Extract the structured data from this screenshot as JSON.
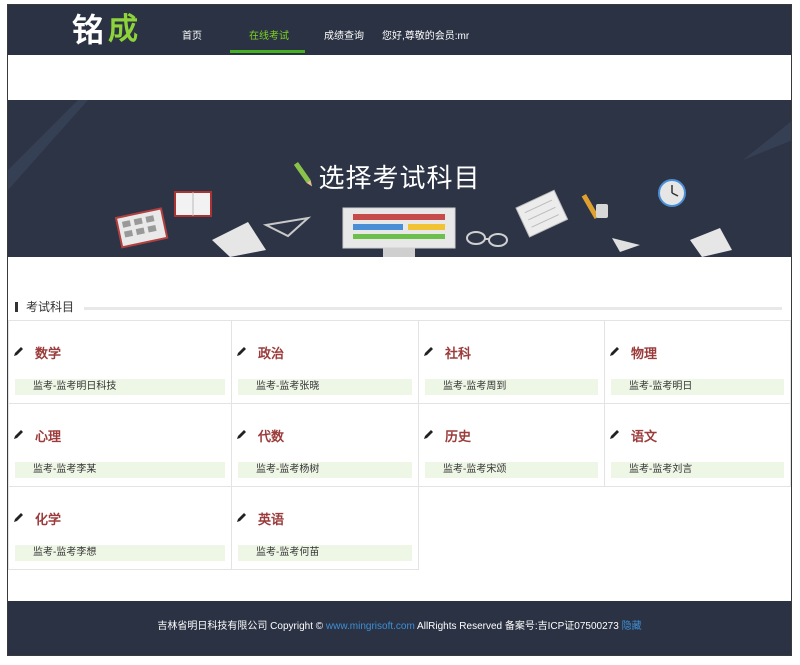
{
  "header": {
    "logo_text": "铭成",
    "nav": [
      {
        "label": "首页",
        "active": false
      },
      {
        "label": "在线考试",
        "active": true
      },
      {
        "label": "成绩查询",
        "active": false
      }
    ],
    "greeting": "您好,尊敬的会员:mr"
  },
  "banner": {
    "title": "选择考试科目"
  },
  "section": {
    "title": "考试科目"
  },
  "subjects": [
    {
      "name": "数学",
      "proctor": "监考-监考明日科技"
    },
    {
      "name": "政治",
      "proctor": "监考-监考张晓"
    },
    {
      "name": "社科",
      "proctor": "监考-监考周到"
    },
    {
      "name": "物理",
      "proctor": "监考-监考明日"
    },
    {
      "name": "心理",
      "proctor": "监考-监考李某"
    },
    {
      "name": "代数",
      "proctor": "监考-监考杨树"
    },
    {
      "name": "历史",
      "proctor": "监考-监考宋颂"
    },
    {
      "name": "语文",
      "proctor": "监考-监考刘言"
    },
    {
      "name": "化学",
      "proctor": "监考-监考李想"
    },
    {
      "name": "英语",
      "proctor": "监考-监考何苗"
    }
  ],
  "footer": {
    "company": "吉林省明日科技有限公司 Copyright ©",
    "link": "www.mingrisoft.com",
    "rights": "AllRights Reserved 备案号:吉ICP证07500273",
    "hidden_link": "隐藏"
  },
  "colors": {
    "header_bg": "#2a3243",
    "nav_active": "#7ed321",
    "subject_text": "#9b3b3b",
    "proctor_bg": "#eef6e6",
    "link": "#3f8fd6"
  }
}
